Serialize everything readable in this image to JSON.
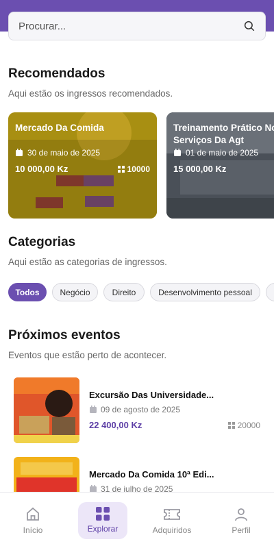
{
  "search": {
    "placeholder": "Procurar..."
  },
  "recommended": {
    "title": "Recomendados",
    "subtitle": "Aqui estão os ingressos recomendados.",
    "cards": [
      {
        "title": "Mercado Da Comida",
        "date": "30 de maio de 2025",
        "price": "10 000,00 Kz",
        "quantity": "10000"
      },
      {
        "title": "Treinamento Prático Nos Serviços Da Agt",
        "date": "01 de maio de 2025",
        "price": "15 000,00 Kz",
        "quantity": ""
      }
    ]
  },
  "categories": {
    "title": "Categorias",
    "subtitle": "Aqui estão as categorias de ingressos.",
    "chips": [
      "Todos",
      "Negócio",
      "Direito",
      "Desenvolvimento pessoal"
    ],
    "active": "Todos"
  },
  "upcoming": {
    "title": "Próximos eventos",
    "subtitle": "Eventos que estão perto de acontecer.",
    "events": [
      {
        "title": "Excursão Das Universidade...",
        "date": "09 de agosto de 2025",
        "price": "22 400,00 Kz",
        "quantity": "20000"
      },
      {
        "title": "Mercado Da Comida 10ª Edi...",
        "date": "31 de julho de 2025",
        "price": "",
        "quantity": ""
      }
    ]
  },
  "bottom_nav": [
    {
      "label": "Início",
      "icon": "home-icon"
    },
    {
      "label": "Explorar",
      "icon": "grid-icon",
      "active": true
    },
    {
      "label": "Adquiridos",
      "icon": "ticket-icon"
    },
    {
      "label": "Perfil",
      "icon": "user-icon"
    }
  ],
  "colors": {
    "accent": "#6b4fb0",
    "price": "#5d3fa6"
  }
}
